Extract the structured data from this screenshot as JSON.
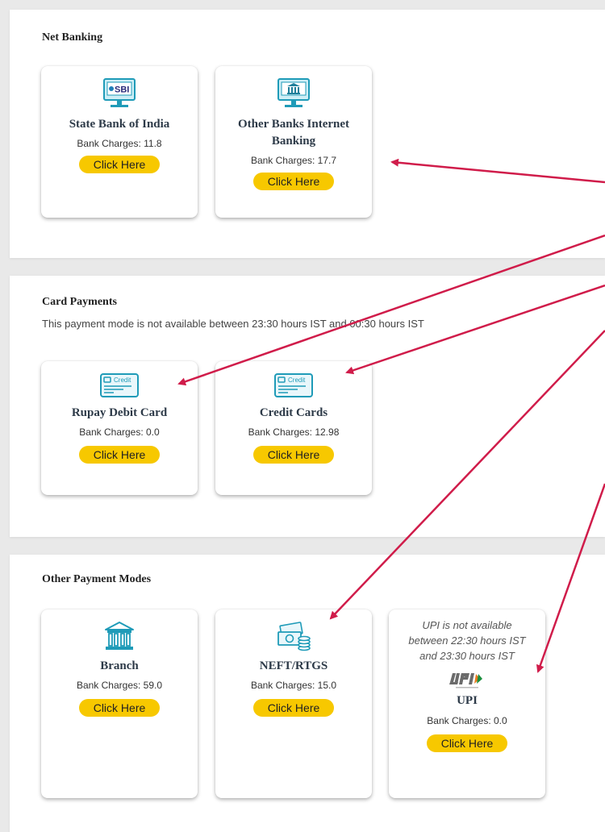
{
  "net_banking": {
    "title": "Net Banking",
    "cards": [
      {
        "icon": "sbi-monitor-icon",
        "title": "State Bank of India",
        "charges": "Bank Charges: 11.8",
        "button": "Click Here"
      },
      {
        "icon": "bank-monitor-icon",
        "title_line1": "Other Banks Internet",
        "title_line2": "Banking",
        "charges": "Bank Charges: 17.7",
        "button": "Click Here"
      }
    ]
  },
  "card_payments": {
    "title": "Card Payments",
    "note": "This payment mode is not available between 23:30 hours IST and 00:30 hours IST",
    "cards": [
      {
        "icon": "credit-card-icon",
        "title": "Rupay Debit Card",
        "charges": "Bank Charges: 0.0",
        "button": "Click Here"
      },
      {
        "icon": "credit-card-icon",
        "title": "Credit Cards",
        "charges": "Bank Charges: 12.98",
        "button": "Click Here"
      }
    ]
  },
  "other_modes": {
    "title": "Other Payment Modes",
    "cards": [
      {
        "icon": "bank-building-icon",
        "title": "Branch",
        "charges": "Bank Charges: 59.0",
        "button": "Click Here"
      },
      {
        "icon": "cash-coins-icon",
        "title": "NEFT/RTGS",
        "charges": "Bank Charges: 15.0",
        "button": "Click Here"
      },
      {
        "icon": "upi-logo-icon",
        "note_line1": "UPI is not available",
        "note_line2": "between 22:30 hours IST",
        "note_line3": "and 23:30 hours IST",
        "title": "UPI",
        "charges": "Bank Charges: 0.0",
        "button": "Click Here"
      }
    ]
  },
  "icon_text": {
    "sbi": "SBI",
    "credit": "Credit"
  },
  "colors": {
    "accent_button": "#f7c800",
    "icon_teal": "#1f9bb8",
    "arrow": "#d01c4a"
  }
}
